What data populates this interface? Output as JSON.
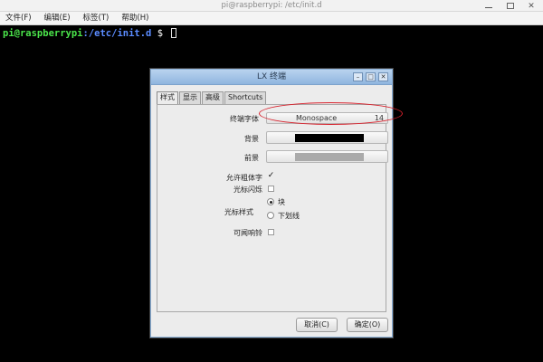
{
  "terminal": {
    "title": "pi@raspberrypi: /etc/init.d",
    "menu": [
      "文件(F)",
      "编辑(E)",
      "标签(T)",
      "帮助(H)"
    ],
    "prompt_user": "pi@raspberrypi",
    "prompt_path": ":/etc/init.d",
    "prompt_sign": " $ "
  },
  "dialog": {
    "title": "LX 终端",
    "tabs": [
      "样式",
      "显示",
      "高级",
      "Shortcuts"
    ],
    "active_tab": "样式",
    "font_label": "终端字体",
    "font_name": "Monospace",
    "font_size": "14",
    "background_label": "背景",
    "background_color": "#000000",
    "foreground_label": "前景",
    "foreground_color": "#aaaaaa",
    "allow_bold_label": "允许粗体字",
    "allow_bold_checked": true,
    "cursor_blink_label": "光标闪烁",
    "cursor_blink_checked": false,
    "cursor_style_label": "光标样式",
    "cursor_style_options": [
      "块",
      "下划线"
    ],
    "cursor_style_selected": "块",
    "audible_bell_label": "可闻响铃",
    "audible_bell_checked": false,
    "cancel_label": "取消(C)",
    "ok_label": "确定(O)"
  }
}
